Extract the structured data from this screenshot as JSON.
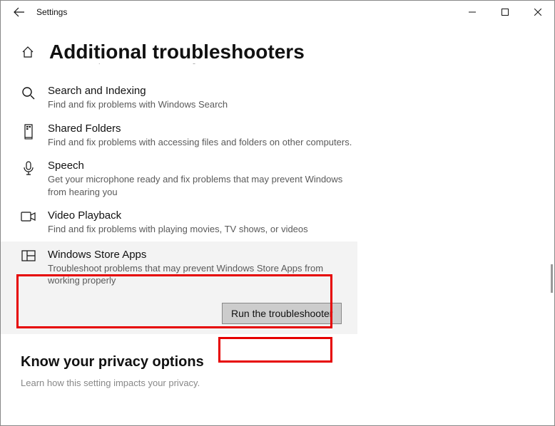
{
  "window": {
    "title": "Settings"
  },
  "page": {
    "heading": "Additional troubleshooters",
    "cutoff_text": "Find and fix problems with recording sound"
  },
  "items": {
    "search": {
      "title": "Search and Indexing",
      "desc": "Find and fix problems with Windows Search"
    },
    "shared": {
      "title": "Shared Folders",
      "desc": "Find and fix problems with accessing files and folders on other computers."
    },
    "speech": {
      "title": "Speech",
      "desc": "Get your microphone ready and fix problems that may prevent Windows from hearing you"
    },
    "video": {
      "title": "Video Playback",
      "desc": "Find and fix problems with playing movies, TV shows, or videos"
    },
    "store": {
      "title": "Windows Store Apps",
      "desc": "Troubleshoot problems that may prevent Windows Store Apps from working properly"
    }
  },
  "buttons": {
    "run": "Run the troubleshooter"
  },
  "privacy": {
    "heading": "Know your privacy options",
    "desc": "Learn how this setting impacts your privacy."
  }
}
